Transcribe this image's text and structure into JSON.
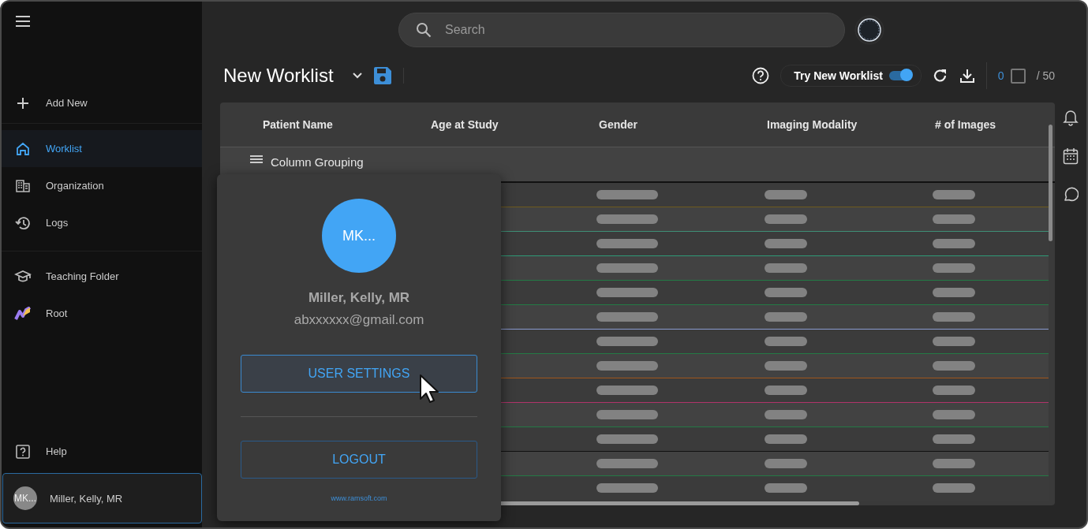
{
  "sidebar": {
    "add_new": {
      "label": "Add New"
    },
    "items": [
      {
        "label": "Worklist",
        "selected": true
      },
      {
        "label": "Organization",
        "selected": false
      },
      {
        "label": "Logs",
        "selected": false
      },
      {
        "label": "Teaching Folder",
        "selected": false
      },
      {
        "label": "Root",
        "selected": false
      }
    ],
    "help": {
      "label": "Help"
    },
    "user": {
      "initials": "MK...",
      "name": "Miller, Kelly, MR",
      "expanded": true
    }
  },
  "search": {
    "placeholder": "Search"
  },
  "worklist": {
    "title": "New Worklist"
  },
  "toolbar": {
    "toggle": {
      "label": "Try New Worklist",
      "on": true
    },
    "selected_count": "0",
    "select_all_checked": false,
    "total": "/ 50"
  },
  "table": {
    "columns": [
      "Patient Name",
      "Age at Study",
      "Gender",
      "Imaging Modality",
      "# of Images"
    ],
    "grouping": {
      "label": "Column Grouping"
    },
    "rows": [
      {
        "color": "#6e5a1e"
      },
      {
        "color": "#3f8f76"
      },
      {
        "color": "#2f9a76"
      },
      {
        "color": "#237a45"
      },
      {
        "color": "#237a45"
      },
      {
        "color": "#8a9ad0"
      },
      {
        "color": "#237a45"
      },
      {
        "color": "#a0561c"
      },
      {
        "color": "#b0346a"
      },
      {
        "color": "#237a45"
      },
      {
        "color": "#111111"
      },
      {
        "color": "#237a45"
      },
      {}
    ]
  },
  "user_menu": {
    "initials": "MK...",
    "name": "Miller, Kelly, MR",
    "email": "abxxxxxx@gmail.com",
    "buttons": [
      {
        "label": "USER SETTINGS",
        "hovered": true
      },
      {
        "label": "LOGOUT",
        "hovered": false
      }
    ],
    "link": "www.ramsoft.com"
  }
}
